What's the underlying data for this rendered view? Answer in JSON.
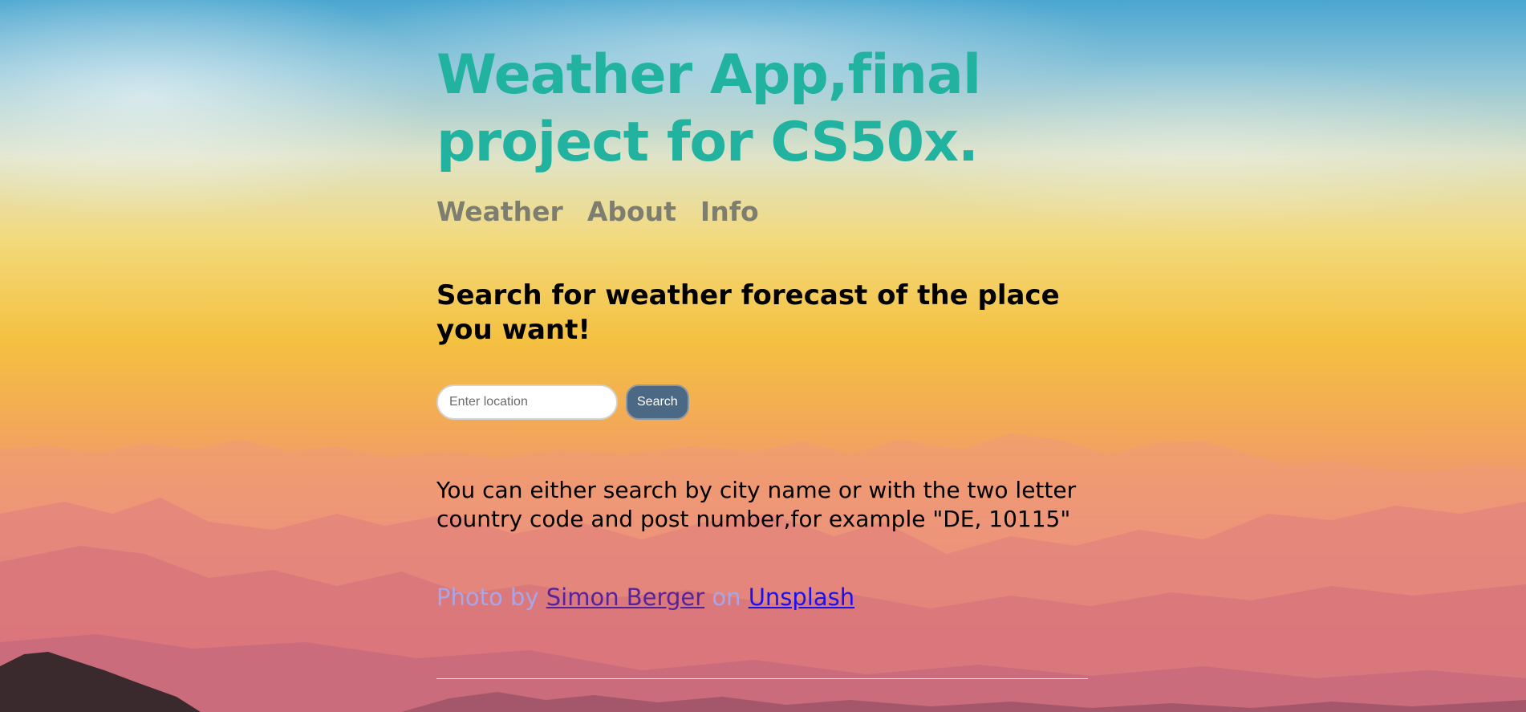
{
  "header": {
    "title": "Weather App,final project for CS50x."
  },
  "nav": {
    "items": [
      {
        "label": "Weather"
      },
      {
        "label": "About"
      },
      {
        "label": "Info"
      }
    ]
  },
  "main": {
    "headline": "Search for weather forecast of the place you want!",
    "search": {
      "placeholder": "Enter location",
      "value": "",
      "button_label": "Search"
    },
    "info_text": "You can either search by city name or with the two letter country code and post number,for example \"DE, 10115\""
  },
  "credit": {
    "prefix": "Photo by",
    "author": "Simon Berger",
    "middle": "on",
    "site": "Unsplash"
  },
  "colors": {
    "title": "#22b3a0",
    "nav": "#7e7e70",
    "button_bg": "#4b6884",
    "credit_text": "#a8a6e6",
    "visited_link": "#56249a",
    "link": "#1a12ee"
  }
}
